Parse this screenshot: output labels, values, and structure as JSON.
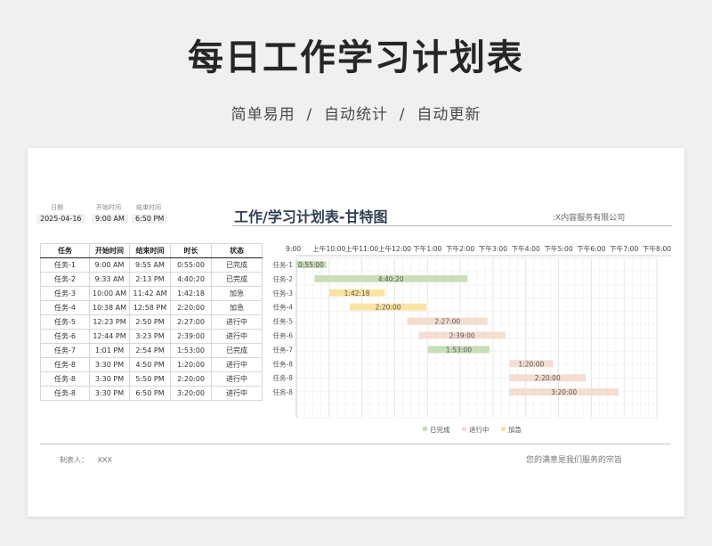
{
  "hero": {
    "title": "每日工作学习计划表",
    "subtitle": "简单易用  /  自动统计  /  自动更新"
  },
  "meta": [
    {
      "label": "日期",
      "value": "2025-04-16"
    },
    {
      "label": "开始时间",
      "value": "9:00 AM"
    },
    {
      "label": "结束时间",
      "value": "6:50 PM"
    }
  ],
  "sheet": {
    "title": "工作/学习计划表-甘特图",
    "company": ":X内容服务有限公司"
  },
  "table": {
    "headers": [
      "任务",
      "开始时间",
      "结束时间",
      "时长",
      "状态"
    ],
    "rows": [
      [
        "任务-1",
        "9:00 AM",
        "9:55 AM",
        "0:55:00",
        "已完成"
      ],
      [
        "任务-2",
        "9:33 AM",
        "2:13 PM",
        "4:40:20",
        "已完成"
      ],
      [
        "任务-3",
        "10:00 AM",
        "11:42 AM",
        "1:42:18",
        "加急"
      ],
      [
        "任务-4",
        "10:38 AM",
        "12:58 PM",
        "2:20:00",
        "加急"
      ],
      [
        "任务-5",
        "12:23 PM",
        "2:50 PM",
        "2:27:00",
        "进行中"
      ],
      [
        "任务-6",
        "12:44 PM",
        "3:23 PM",
        "2:39:00",
        "进行中"
      ],
      [
        "任务-7",
        "1:01 PM",
        "2:54 PM",
        "1:53:00",
        "已完成"
      ],
      [
        "任务-8",
        "3:30 PM",
        "4:50 PM",
        "1:20:00",
        "进行中"
      ],
      [
        "任务-8",
        "3:30 PM",
        "5:50 PM",
        "2:20:00",
        "进行中"
      ],
      [
        "任务-8",
        "3:30 PM",
        "6:50 PM",
        "3:20:00",
        "进行中"
      ]
    ]
  },
  "chart_data": {
    "type": "bar",
    "orientation": "horizontal-gantt",
    "x_ticks": [
      "9:00",
      "上午10:00",
      "上午11:00",
      "上午12:00",
      "下午1:00",
      "下午2:00",
      "下午3:00",
      "下午4:00",
      "下午5:00",
      "下午6:00",
      "下午7:00",
      "下午8:00"
    ],
    "xlim": [
      "9:00",
      "20:00"
    ],
    "grid": true,
    "legend_position": "bottom",
    "colors": {
      "已完成": "#c9dfb9",
      "进行中": "#f6ddd2",
      "加急": "#fbe3a3"
    },
    "tasks": [
      {
        "name": "任务-1",
        "start": "9:00",
        "end": "9:55",
        "label": "0:55:00",
        "status": "已完成"
      },
      {
        "name": "任务-2",
        "start": "9:33",
        "end": "14:13",
        "label": "4:40:20",
        "status": "已完成"
      },
      {
        "name": "任务-3",
        "start": "10:00",
        "end": "11:42",
        "label": "1:42:18",
        "status": "加急"
      },
      {
        "name": "任务-4",
        "start": "10:38",
        "end": "12:58",
        "label": "2:20:00",
        "status": "加急"
      },
      {
        "name": "任务-5",
        "start": "12:23",
        "end": "14:50",
        "label": "2:27:00",
        "status": "进行中"
      },
      {
        "name": "任务-6",
        "start": "12:44",
        "end": "15:23",
        "label": "2:39:00",
        "status": "进行中"
      },
      {
        "name": "任务-7",
        "start": "13:01",
        "end": "14:54",
        "label": "1:53:00",
        "status": "已完成"
      },
      {
        "name": "任务-8",
        "start": "15:30",
        "end": "16:50",
        "label": "1:20:00",
        "status": "进行中"
      },
      {
        "name": "任务-8",
        "start": "15:30",
        "end": "17:50",
        "label": "2:20:00",
        "status": "进行中"
      },
      {
        "name": "任务-8",
        "start": "15:30",
        "end": "18:50",
        "label": "3:20:00",
        "status": "进行中"
      }
    ],
    "legend": [
      "已完成",
      "进行中",
      "加急"
    ]
  },
  "footer": {
    "maker_label": "制表人：",
    "maker": "XXX",
    "slogan": "您的满意是我们服务的宗旨"
  }
}
